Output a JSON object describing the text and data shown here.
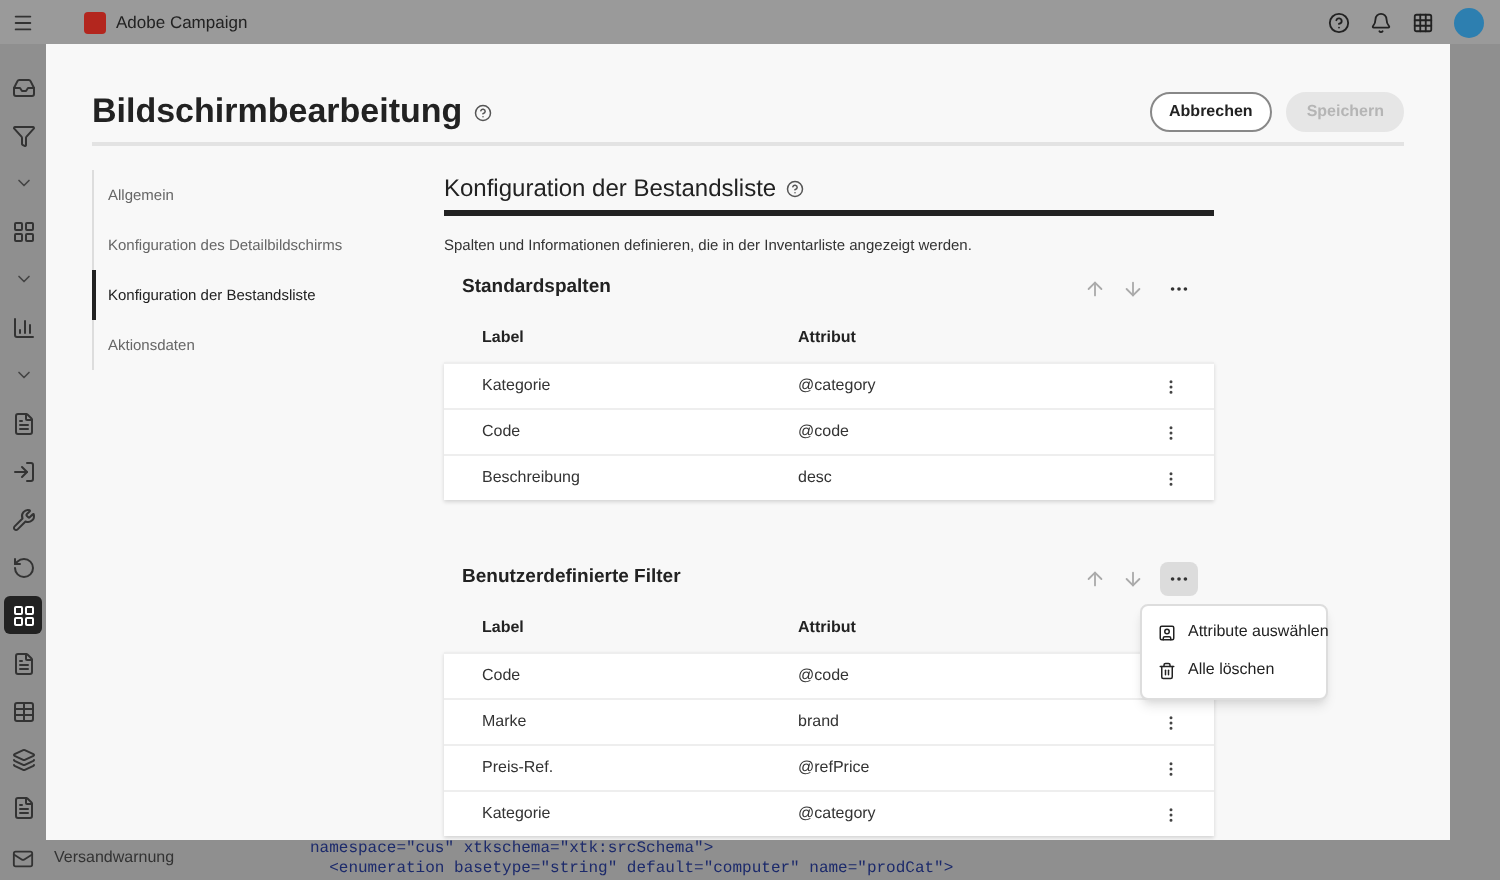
{
  "app_bar": {
    "product": "Adobe Campaign"
  },
  "rail": [
    {
      "kind": "icon",
      "selected": false
    },
    {
      "kind": "icon",
      "selected": false
    },
    {
      "kind": "chevron"
    },
    {
      "kind": "icon",
      "selected": false
    },
    {
      "kind": "chevron"
    },
    {
      "kind": "icon",
      "selected": false
    },
    {
      "kind": "chevron"
    },
    {
      "kind": "icon",
      "selected": false
    },
    {
      "kind": "icon",
      "selected": false
    },
    {
      "kind": "icon",
      "selected": false
    },
    {
      "kind": "icon",
      "selected": false
    },
    {
      "kind": "icon",
      "selected": true
    },
    {
      "kind": "icon",
      "selected": false
    },
    {
      "kind": "icon",
      "selected": false
    },
    {
      "kind": "icon",
      "selected": false
    },
    {
      "kind": "icon",
      "selected": false
    }
  ],
  "background": {
    "sidebar_item": "Versandwarnung",
    "code_lines": [
      "namespace=\"cus\" xtkschema=\"xtk:srcSchema\">",
      "  <enumeration basetype=\"string\" default=\"computer\" name=\"prodCat\">"
    ]
  },
  "dialog": {
    "title": "Bildschirmbearbeitung",
    "buttons": [
      {
        "label": "Abbrechen",
        "disabled": false
      },
      {
        "label": "Speichern",
        "disabled": true
      }
    ],
    "nav": [
      {
        "label": "Allgemein",
        "selected": false
      },
      {
        "label": "Konfiguration des Detailbildschirms",
        "selected": false
      },
      {
        "label": "Konfiguration der Bestandsliste",
        "selected": true
      },
      {
        "label": "Aktionsdaten",
        "selected": false
      }
    ],
    "heading": "Konfiguration der Bestandsliste",
    "description": "Spalten und Informationen definieren, die in der Inventarliste angezeigt werden.",
    "sections": [
      {
        "title": "Standardspalten",
        "menu_open": false,
        "columns": [
          "Label",
          "Attribut"
        ],
        "rows": [
          [
            "Kategorie",
            "@category"
          ],
          [
            "Code",
            "@code"
          ],
          [
            "Beschreibung",
            "desc"
          ]
        ]
      },
      {
        "title": "Benutzerdefinierte Filter",
        "menu_open": true,
        "menu": [
          "Attribute auswählen",
          "Alle löschen"
        ],
        "columns": [
          "Label",
          "Attribut"
        ],
        "rows": [
          [
            "Code",
            "@code"
          ],
          [
            "Marke",
            "brand"
          ],
          [
            "Preis-Ref.",
            "@refPrice"
          ],
          [
            "Kategorie",
            "@category"
          ]
        ]
      }
    ]
  }
}
